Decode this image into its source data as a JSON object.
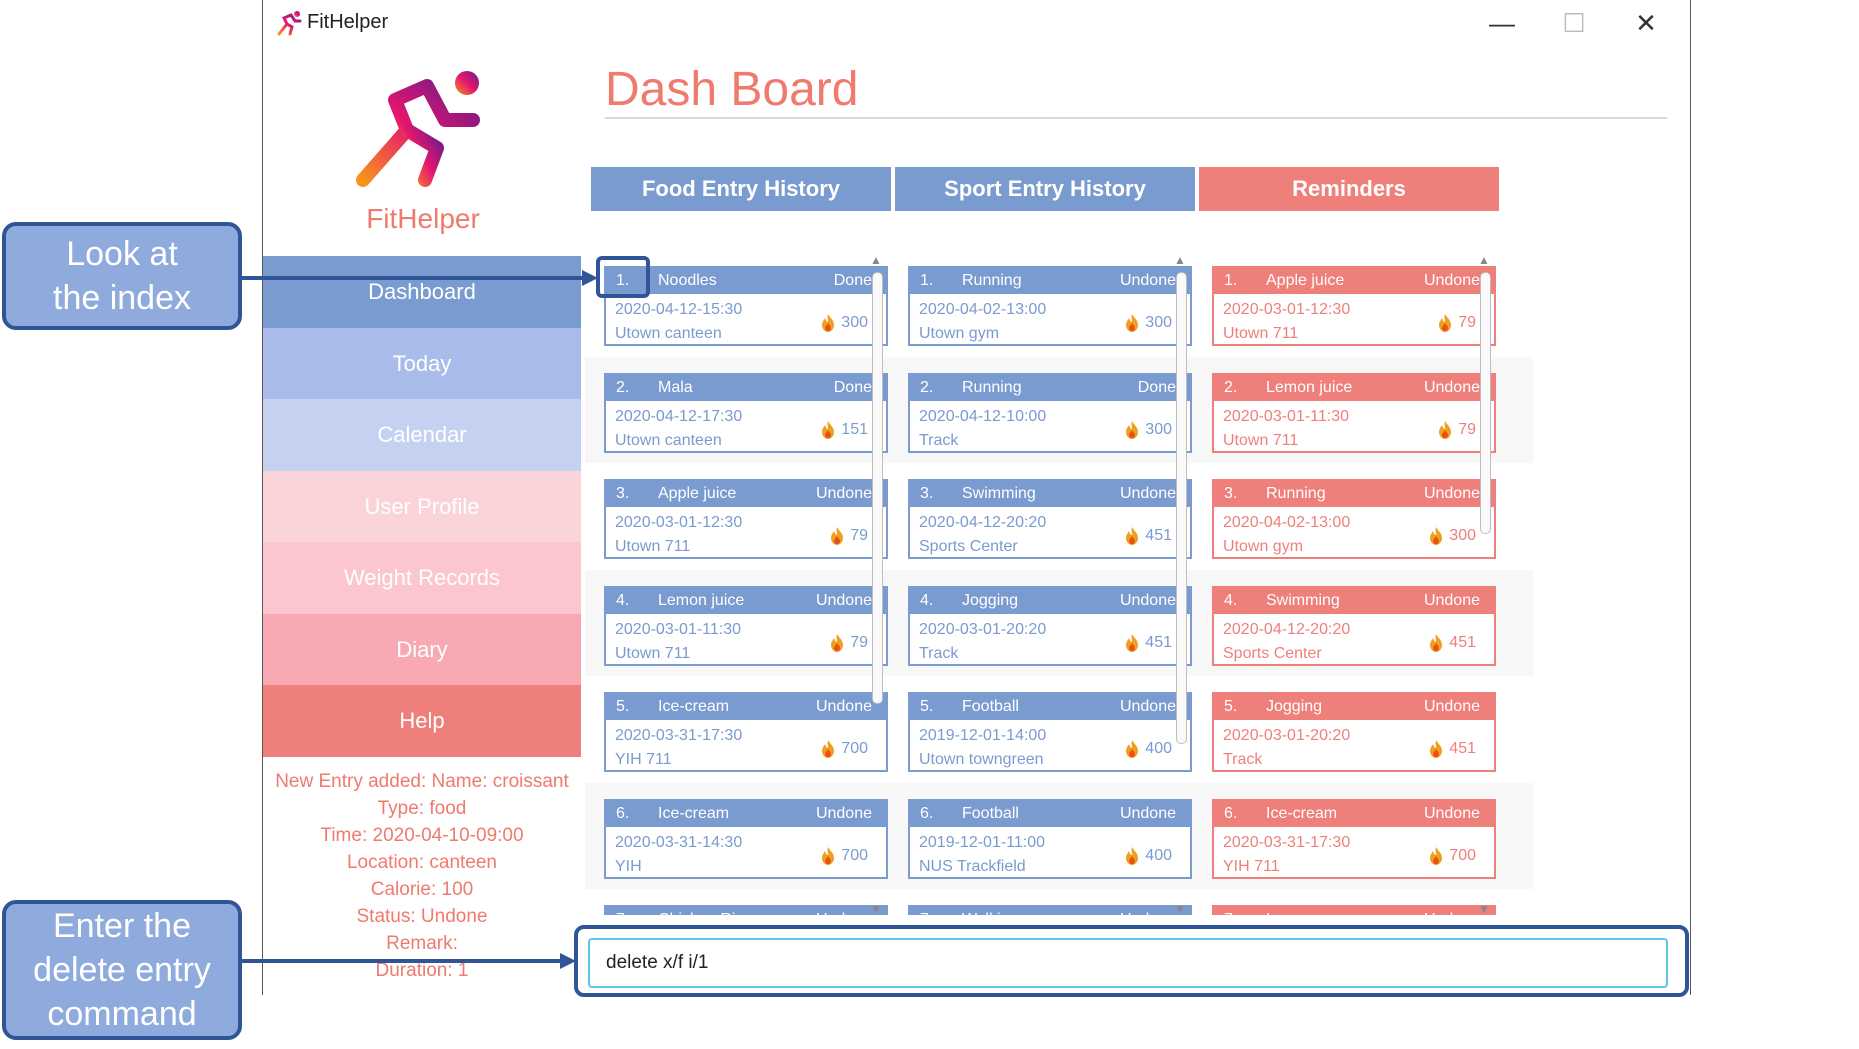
{
  "window": {
    "title": "FitHelper",
    "controls": {
      "minimize": "—",
      "maximize": "☐",
      "close": "✕"
    }
  },
  "sidebar": {
    "brand": "FitHelper",
    "nav": [
      {
        "label": "Dashboard",
        "color": "#7a9bcf"
      },
      {
        "label": "Today",
        "color": "#a9bbe8"
      },
      {
        "label": "Calendar",
        "color": "#c4d1f0"
      },
      {
        "label": "User Profile",
        "color": "#fbd4da"
      },
      {
        "label": "Weight Records",
        "color": "#fcc6cf"
      },
      {
        "label": "Diary",
        "color": "#f9a9b4"
      },
      {
        "label": "Help",
        "color": "#ef7f7a"
      }
    ],
    "result_lines": [
      "New Entry added: Name: croissant",
      "Type: food",
      "Time: 2020-04-10-09:00",
      "Location: canteen",
      "Calorie: 100",
      "Status: Undone",
      "Remark:",
      "Duration: 1"
    ]
  },
  "main": {
    "title": "Dash Board",
    "columns": {
      "food": {
        "header": "Food Entry History",
        "color": "#7a9bcf",
        "entries": [
          {
            "index": "1.",
            "name": "Noodles",
            "status": "Done",
            "time": "2020-04-12-15:30",
            "location": "Utown canteen",
            "calorie": "300"
          },
          {
            "index": "2.",
            "name": "Mala",
            "status": "Done",
            "time": "2020-04-12-17:30",
            "location": "Utown canteen",
            "calorie": "151"
          },
          {
            "index": "3.",
            "name": "Apple juice",
            "status": "Undone",
            "time": "2020-03-01-12:30",
            "location": "Utown 711",
            "calorie": "79"
          },
          {
            "index": "4.",
            "name": "Lemon juice",
            "status": "Undone",
            "time": "2020-03-01-11:30",
            "location": "Utown 711",
            "calorie": "79"
          },
          {
            "index": "5.",
            "name": "Ice-cream",
            "status": "Undone",
            "time": "2020-03-31-17:30",
            "location": "YIH 711",
            "calorie": "700"
          },
          {
            "index": "6.",
            "name": "Ice-cream",
            "status": "Undone",
            "time": "2020-03-31-14:30",
            "location": "YIH",
            "calorie": "700"
          },
          {
            "index": "7.",
            "name": "Chicken Rice",
            "status": "Undone",
            "time": "",
            "location": "",
            "calorie": ""
          }
        ]
      },
      "sport": {
        "header": "Sport Entry History",
        "color": "#7a9bcf",
        "entries": [
          {
            "index": "1.",
            "name": "Running",
            "status": "Undone",
            "time": "2020-04-02-13:00",
            "location": "Utown gym",
            "calorie": "300"
          },
          {
            "index": "2.",
            "name": "Running",
            "status": "Done",
            "time": "2020-04-12-10:00",
            "location": "Track",
            "calorie": "300"
          },
          {
            "index": "3.",
            "name": "Swimming",
            "status": "Undone",
            "time": "2020-04-12-20:20",
            "location": "Sports Center",
            "calorie": "451"
          },
          {
            "index": "4.",
            "name": "Jogging",
            "status": "Undone",
            "time": "2020-03-01-20:20",
            "location": "Track",
            "calorie": "451"
          },
          {
            "index": "5.",
            "name": "Football",
            "status": "Undone",
            "time": "2019-12-01-14:00",
            "location": "Utown towngreen",
            "calorie": "400"
          },
          {
            "index": "6.",
            "name": "Football",
            "status": "Undone",
            "time": "2019-12-01-11:00",
            "location": "NUS Trackfield",
            "calorie": "400"
          },
          {
            "index": "7.",
            "name": "Walking",
            "status": "Undone",
            "time": "",
            "location": "",
            "calorie": ""
          }
        ]
      },
      "reminders": {
        "header": "Reminders",
        "color": "#ef7f7a",
        "entries": [
          {
            "index": "1.",
            "name": "Apple juice",
            "status": "Undone",
            "time": "2020-03-01-12:30",
            "location": "Utown 711",
            "calorie": "79"
          },
          {
            "index": "2.",
            "name": "Lemon juice",
            "status": "Undone",
            "time": "2020-03-01-11:30",
            "location": "Utown 711",
            "calorie": "79"
          },
          {
            "index": "3.",
            "name": "Running",
            "status": "Undone",
            "time": "2020-04-02-13:00",
            "location": "Utown gym",
            "calorie": "300"
          },
          {
            "index": "4.",
            "name": "Swimming",
            "status": "Undone",
            "time": "2020-04-12-20:20",
            "location": "Sports Center",
            "calorie": "451"
          },
          {
            "index": "5.",
            "name": "Jogging",
            "status": "Undone",
            "time": "2020-03-01-20:20",
            "location": "Track",
            "calorie": "451"
          },
          {
            "index": "6.",
            "name": "Ice-cream",
            "status": "Undone",
            "time": "2020-03-31-17:30",
            "location": "YIH 711",
            "calorie": "700"
          },
          {
            "index": "7.",
            "name": "Ice-cream",
            "status": "Undone",
            "time": "",
            "location": "",
            "calorie": ""
          }
        ]
      }
    },
    "command_input": {
      "value": "delete x/f i/1"
    }
  },
  "annotations": {
    "look_index": [
      "Look at",
      "the index"
    ],
    "enter_command": [
      "Enter the",
      "delete entry",
      "command"
    ],
    "color": "#2f5597"
  }
}
